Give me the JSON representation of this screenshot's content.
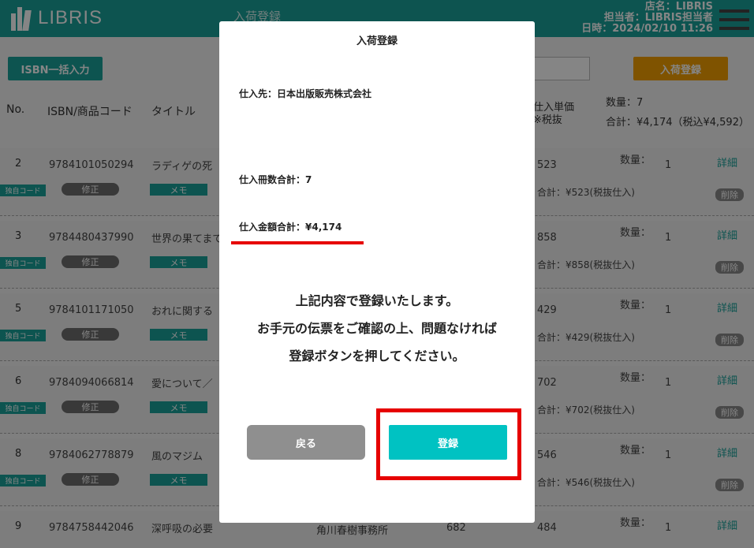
{
  "header": {
    "app_name": "LIBRIS",
    "page_title": "入荷登録",
    "store": "店名：LIBRIS",
    "staff": "担当者：LIBRIS担当者",
    "datetime": "日時：2024/02/10  11:26"
  },
  "toolbar": {
    "isbn_bulk_label": "ISBN一括入力",
    "register_label": "入荷登録"
  },
  "columns": {
    "no": "No.",
    "isbn": "ISBN/商品コード",
    "title": "タイトル",
    "unit_price": "仕入単価",
    "tax_note": "※税抜"
  },
  "summary": {
    "qty": "数量：7",
    "total": "合計：¥4,174（税込¥4,592）"
  },
  "rows": [
    {
      "no": "2",
      "isbn": "9784101050294",
      "title": "ラディゲの死",
      "unit": "523",
      "subtotal": "合計：¥523(税抜仕入)",
      "qty_label": "数量：",
      "qty": "1",
      "detail": "詳細",
      "delete": "削除",
      "own_code": "独自コード",
      "fix": "修正",
      "memo": "メモ"
    },
    {
      "no": "3",
      "isbn": "9784480437990",
      "title": "世界の果てまで",
      "unit": "858",
      "subtotal": "合計：¥858(税抜仕入)",
      "qty_label": "数量：",
      "qty": "1",
      "detail": "詳細",
      "delete": "削除",
      "own_code": "独自コード",
      "fix": "修正",
      "memo": "メモ"
    },
    {
      "no": "5",
      "isbn": "9784101171050",
      "title": "おれに関する",
      "unit": "429",
      "subtotal": "合計：¥429(税抜仕入)",
      "qty_label": "数量：",
      "qty": "1",
      "detail": "詳細",
      "delete": "削除",
      "own_code": "独自コード",
      "fix": "修正",
      "memo": "メモ"
    },
    {
      "no": "6",
      "isbn": "9784094066814",
      "title": "愛について／",
      "unit": "702",
      "subtotal": "合計：¥702(税抜仕入)",
      "qty_label": "数量：",
      "qty": "1",
      "detail": "詳細",
      "delete": "削除",
      "own_code": "独自コード",
      "fix": "修正",
      "memo": "メモ"
    },
    {
      "no": "8",
      "isbn": "9784062778879",
      "title": "風のマジム",
      "unit": "546",
      "subtotal": "合計：¥546(税抜仕入)",
      "qty_label": "数量：",
      "qty": "1",
      "detail": "詳細",
      "delete": "削除",
      "own_code": "独自コード",
      "fix": "修正",
      "memo": "メモ"
    },
    {
      "no": "9",
      "isbn": "9784758442046",
      "title": "深呼吸の必要",
      "publisher": "角川春樹事務所",
      "count": "682",
      "unit": "484",
      "qty_label": "数量：",
      "qty": "1",
      "detail": "詳細"
    }
  ],
  "modal": {
    "title": "入荷登録",
    "supplier": "仕入先：日本出版販売株式会社",
    "count_total": "仕入冊数合計：7",
    "amount_total": "仕入金額合計：¥4,174",
    "message_line1": "上記内容で登録いたします。",
    "message_line2": "お手元の伝票をご確認の上、問題なければ",
    "message_line3": "登録ボタンを押してください。",
    "back_label": "戻る",
    "confirm_label": "登録"
  },
  "colors": {
    "brand": "#1aa19a",
    "accent_orange": "#f3a000",
    "confirm": "#00c2c2",
    "highlight_red": "#e60000"
  }
}
